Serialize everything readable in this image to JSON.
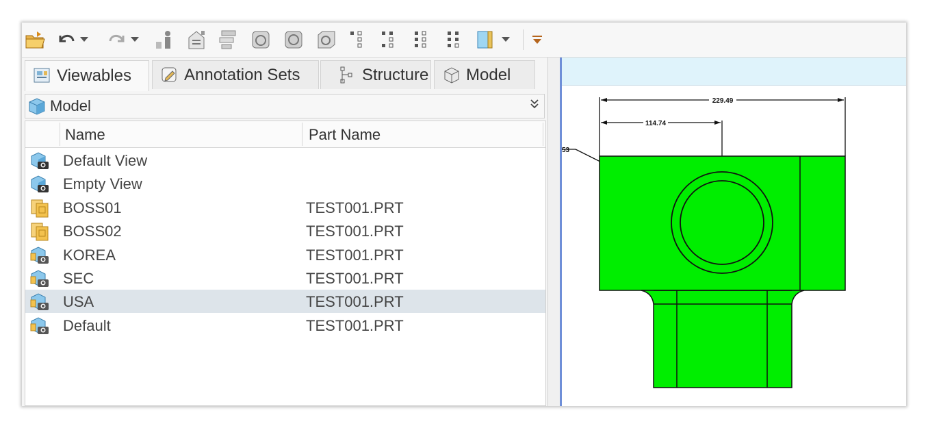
{
  "toolbar": {
    "icons": [
      "open-folder-icon",
      "undo-icon",
      "undo-dropdown-icon",
      "redo-icon",
      "redo-dropdown-icon",
      "person-icon",
      "properties-icon",
      "list-icon",
      "cube-view-1-icon",
      "cube-view-2-icon",
      "cube-view-3-icon",
      "tree-1-icon",
      "tree-2-icon",
      "tree-3-icon",
      "tree-4-icon",
      "book-icon",
      "book-dropdown-icon",
      "toolbar-overflow-icon"
    ]
  },
  "tabs": [
    {
      "label": "Viewables",
      "icon": "viewables-icon",
      "active": true
    },
    {
      "label": "Annotation Sets",
      "icon": "annotation-icon",
      "active": false
    },
    {
      "label": "Structure",
      "icon": "structure-icon",
      "active": false
    },
    {
      "label": "Model",
      "icon": "model-cube-icon",
      "active": false
    }
  ],
  "model_bar": {
    "label": "Model",
    "collapse": "»"
  },
  "table": {
    "columns": [
      "Name",
      "Part Name"
    ],
    "rows": [
      {
        "name": "Default View",
        "part": "",
        "icon": "camera-view-icon",
        "selected": false
      },
      {
        "name": "Empty View",
        "part": "",
        "icon": "camera-view-icon",
        "selected": false
      },
      {
        "name": "BOSS01",
        "part": "TEST001.PRT",
        "icon": "drawing-view-icon",
        "selected": false
      },
      {
        "name": "BOSS02",
        "part": "TEST001.PRT",
        "icon": "drawing-view-icon",
        "selected": false
      },
      {
        "name": "KOREA",
        "part": "TEST001.PRT",
        "icon": "annotated-view-icon",
        "selected": false
      },
      {
        "name": "SEC",
        "part": "TEST001.PRT",
        "icon": "annotated-view-icon",
        "selected": false
      },
      {
        "name": "USA",
        "part": "TEST001.PRT",
        "icon": "annotated-view-icon",
        "selected": true
      },
      {
        "name": "Default",
        "part": "TEST001.PRT",
        "icon": "annotated-view-icon",
        "selected": false
      }
    ]
  },
  "viewer": {
    "dim_overall": "229.49",
    "dim_center": "114.74",
    "dim_diameter_fragment": "53",
    "part_color": "#00ee00",
    "accent": "#6f8fd8"
  }
}
